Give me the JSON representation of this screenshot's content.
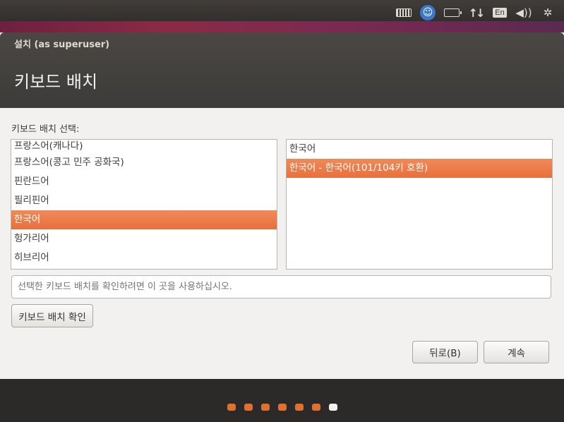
{
  "tray": {
    "icons": [
      "keyboard-icon",
      "accessibility-icon",
      "battery-icon",
      "network-icon",
      "input-method-icon",
      "volume-icon",
      "settings-gear-icon"
    ],
    "input_method_label": "En"
  },
  "window": {
    "title": "설치 (as superuser)",
    "page_title": "키보드 배치"
  },
  "prompt": "키보드 배치 선택:",
  "layouts": [
    {
      "label": "프랑스어(캐나다)",
      "selected": false
    },
    {
      "label": "프랑스어(콩고 민주 공화국)",
      "selected": false
    },
    {
      "label": "핀란드어",
      "selected": false
    },
    {
      "label": "필리핀어",
      "selected": false
    },
    {
      "label": "한국어",
      "selected": true
    },
    {
      "label": "헝가리어",
      "selected": false
    },
    {
      "label": "히브리어",
      "selected": false
    }
  ],
  "variants": [
    {
      "label": "한국어",
      "selected": false
    },
    {
      "label": "한국어 - 한국어(101/104키 호환)",
      "selected": true
    }
  ],
  "test_entry": {
    "placeholder": "선택한 키보드 배치를 확인하려면 이 곳을 사용하십시오.",
    "value": ""
  },
  "buttons": {
    "detect": "키보드 배치 확인",
    "back": "뒤로(B)",
    "continue": "계속"
  },
  "progress": {
    "steps_total": 7,
    "current_step": 7
  },
  "colors": {
    "accent": "#e8703c",
    "panel": "#3d3b39",
    "background": "#f2f1f0"
  }
}
